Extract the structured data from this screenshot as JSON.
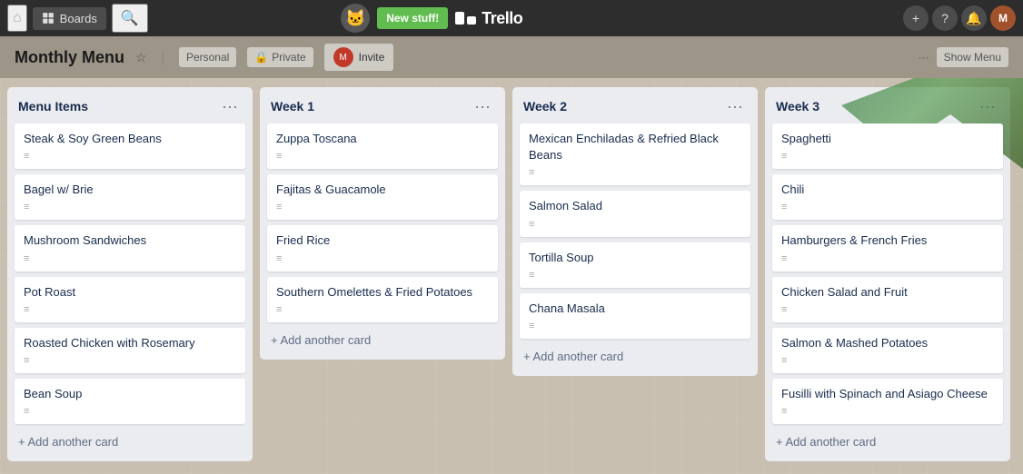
{
  "navbar": {
    "boards_label": "Boards",
    "new_stuff_label": "New stuff!",
    "trello_logo": "Trello",
    "home_icon": "🏠",
    "search_icon": "🔍",
    "add_icon": "+",
    "help_icon": "?",
    "notif_icon": "🔔",
    "avatar_initials": "M"
  },
  "board": {
    "title": "Monthly Menu",
    "personal_label": "Personal",
    "visibility_label": "Private",
    "invite_label": "Invite",
    "show_menu_label": "Show Menu",
    "ellipsis": "···"
  },
  "lists": [
    {
      "id": "menu-items",
      "title": "Menu Items",
      "cards": [
        {
          "title": "Steak & Soy Green Beans",
          "lines": "≡"
        },
        {
          "title": "Bagel w/ Brie",
          "lines": "≡"
        },
        {
          "title": "Mushroom Sandwiches",
          "lines": "≡"
        },
        {
          "title": "Pot Roast",
          "lines": "≡",
          "editable": true
        },
        {
          "title": "Roasted Chicken with Rosemary",
          "lines": "≡"
        },
        {
          "title": "Bean Soup",
          "lines": "≡"
        }
      ],
      "add_card_label": "+ Add another card"
    },
    {
      "id": "week-1",
      "title": "Week 1",
      "cards": [
        {
          "title": "Zuppa Toscana",
          "lines": "≡"
        },
        {
          "title": "Fajitas & Guacamole",
          "lines": "≡"
        },
        {
          "title": "Fried Rice",
          "lines": "≡"
        },
        {
          "title": "Southern Omelettes & Fried Potatoes",
          "lines": "≡"
        }
      ],
      "add_card_label": "+ Add another card"
    },
    {
      "id": "week-2",
      "title": "Week 2",
      "cards": [
        {
          "title": "Mexican Enchiladas & Refried Black Beans",
          "lines": "≡"
        },
        {
          "title": "Salmon Salad",
          "lines": "≡"
        },
        {
          "title": "Tortilla Soup",
          "lines": "≡"
        },
        {
          "title": "Chana Masala",
          "lines": "≡"
        }
      ],
      "add_card_label": "+ Add another card"
    },
    {
      "id": "week-3",
      "title": "Week 3",
      "cards": [
        {
          "title": "Spaghetti",
          "lines": "≡"
        },
        {
          "title": "Chili",
          "lines": "≡"
        },
        {
          "title": "Hamburgers & French Fries",
          "lines": "≡"
        },
        {
          "title": "Chicken Salad and Fruit",
          "lines": "≡"
        },
        {
          "title": "Salmon & Mashed Potatoes",
          "lines": "≡"
        },
        {
          "title": "Fusilli with Spinach and Asiago Cheese",
          "lines": "≡"
        }
      ],
      "add_card_label": "+ Add another card"
    }
  ]
}
